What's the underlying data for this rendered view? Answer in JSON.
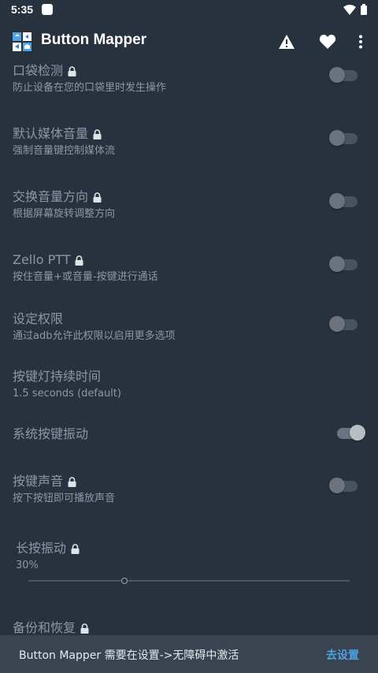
{
  "status_bar": {
    "time": "5:35"
  },
  "app_bar": {
    "title": "Button Mapper"
  },
  "settings": [
    {
      "title": "口袋检测",
      "subtitle": "防止设备在您的口袋里时发生操作",
      "locked": true,
      "switch": "off"
    },
    {
      "title": "默认媒体音量",
      "subtitle": "强制音量键控制媒体流",
      "locked": true,
      "switch": "off"
    },
    {
      "title": "交换音量方向",
      "subtitle": "根据屏幕旋转调整方向",
      "locked": true,
      "switch": "off"
    },
    {
      "title": "Zello PTT",
      "subtitle": "按住音量+或音量-按键进行通话",
      "locked": true,
      "switch": "off"
    },
    {
      "title": "设定权限",
      "subtitle": "通过adb允许此权限以启用更多选项",
      "locked": false,
      "switch": "off"
    },
    {
      "title": "按键灯持续时间",
      "subtitle": "1.5 seconds (default)",
      "locked": false
    },
    {
      "title": "系统按键振动",
      "locked": false,
      "switch": "on"
    },
    {
      "title": "按键声音",
      "subtitle": "按下按钮即可播放声音",
      "locked": true,
      "switch": "off"
    },
    {
      "title": "长按振动",
      "value": "30%",
      "locked": true,
      "slider_percent": 30
    },
    {
      "title": "备份和恢复",
      "locked": true
    }
  ],
  "snackbar": {
    "message": "Button Mapper 需要在设置->无障碍中激活",
    "action": "去设置"
  },
  "colors": {
    "background": "#28323f",
    "snackbar": "#3a4350",
    "accent": "#4aa3e0",
    "text_dim": "#8c97a5"
  },
  "icons": [
    "wifi-icon",
    "battery-icon",
    "warning-icon",
    "heart-icon",
    "more-vert-icon",
    "lock-icon",
    "app-icon"
  ]
}
